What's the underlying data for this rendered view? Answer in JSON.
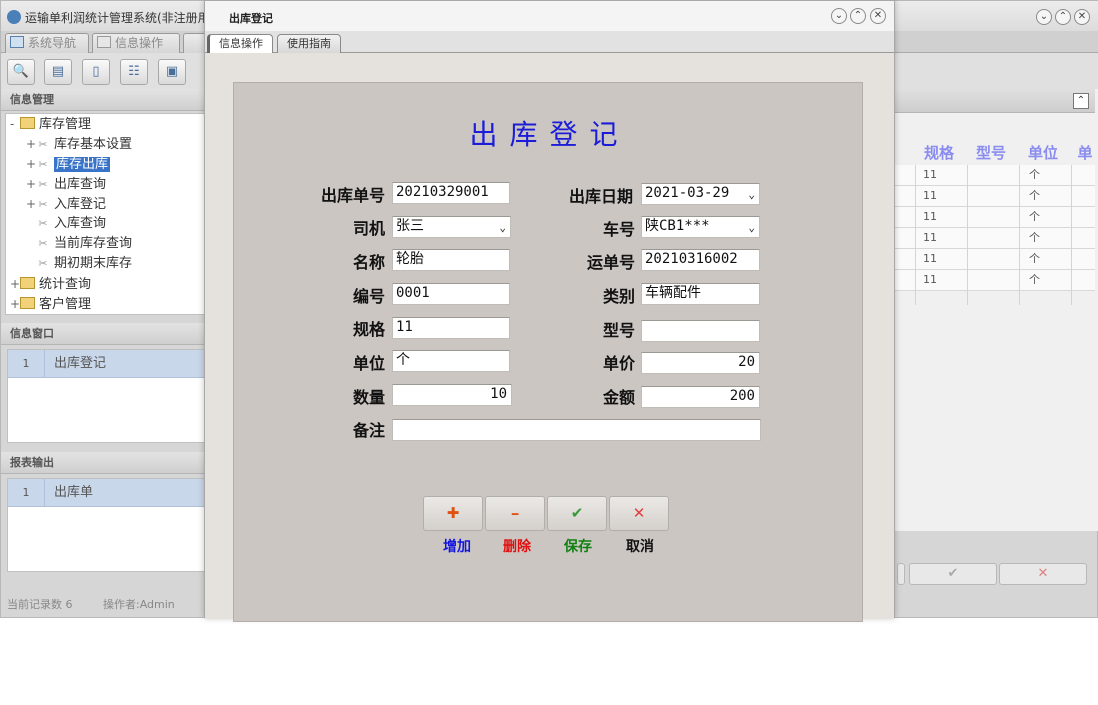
{
  "app": {
    "title": "运输单利润统计管理系统(非注册用户"
  },
  "main_tabs": [
    {
      "label": "系统导航"
    },
    {
      "label": "信息操作"
    }
  ],
  "left": {
    "info_mgmt_title": "信息管理",
    "tree": [
      {
        "label": "库存管理",
        "type": "folder",
        "expanded": true
      },
      {
        "label": "库存基本设置",
        "type": "leaf"
      },
      {
        "label": "库存出库",
        "type": "leaf",
        "selected": true
      },
      {
        "label": "出库查询",
        "type": "leaf"
      },
      {
        "label": "入库登记",
        "type": "leaf"
      },
      {
        "label": "入库查询",
        "type": "leaf"
      },
      {
        "label": "当前库存查询",
        "type": "leaf"
      },
      {
        "label": "期初期末库存",
        "type": "leaf"
      },
      {
        "label": "统计查询",
        "type": "folder"
      },
      {
        "label": "客户管理",
        "type": "folder"
      }
    ],
    "info_window_title": "信息窗口",
    "info_window_items": [
      {
        "num": "1",
        "label": "出库登记"
      }
    ],
    "report_title": "报表输出",
    "report_items": [
      {
        "num": "1",
        "label": "出库单"
      }
    ]
  },
  "status": {
    "records": "当前记录数 6",
    "operator": "操作者:Admin"
  },
  "right_grid": {
    "columns": [
      "规格",
      "型号",
      "单位",
      "单"
    ],
    "rows": [
      {
        "spec": "11",
        "unit": "个"
      },
      {
        "spec": "11",
        "unit": "个"
      },
      {
        "spec": "11",
        "unit": "个"
      },
      {
        "spec": "11",
        "unit": "个"
      },
      {
        "spec": "11",
        "unit": "个"
      },
      {
        "spec": "11",
        "unit": "个"
      }
    ]
  },
  "dialog": {
    "title": "出库登记",
    "tabs": [
      {
        "label": "信息操作"
      },
      {
        "label": "使用指南"
      }
    ],
    "form_title": "出库登记",
    "fields": {
      "out_no": {
        "label": "出库单号",
        "value": "20210329001"
      },
      "out_date": {
        "label": "出库日期",
        "value": "2021-03-29"
      },
      "driver": {
        "label": "司机",
        "value": "张三"
      },
      "plate": {
        "label": "车号",
        "value": "陕CB1***"
      },
      "name": {
        "label": "名称",
        "value": "轮胎"
      },
      "waybill": {
        "label": "运单号",
        "value": "20210316002"
      },
      "code": {
        "label": "编号",
        "value": "0001"
      },
      "category": {
        "label": "类别",
        "value": "车辆配件"
      },
      "spec": {
        "label": "规格",
        "value": "11"
      },
      "model": {
        "label": "型号",
        "value": ""
      },
      "unit": {
        "label": "单位",
        "value": "个"
      },
      "price": {
        "label": "单价",
        "value": "20"
      },
      "qty": {
        "label": "数量",
        "value": "10"
      },
      "amount": {
        "label": "金额",
        "value": "200"
      },
      "remark": {
        "label": "备注",
        "value": ""
      }
    },
    "buttons": {
      "add": {
        "symbol": "✚",
        "label": "增加",
        "color": "#1515e0",
        "icon_color": "#e05010"
      },
      "delete": {
        "symbol": "━",
        "label": "删除",
        "color": "#e01010",
        "icon_color": "#e05010"
      },
      "save": {
        "symbol": "✔",
        "label": "保存",
        "color": "#108010",
        "icon_color": "#3a9a3a"
      },
      "cancel": {
        "symbol": "✕",
        "label": "取消",
        "color": "#111111",
        "icon_color": "#e04040"
      }
    }
  }
}
